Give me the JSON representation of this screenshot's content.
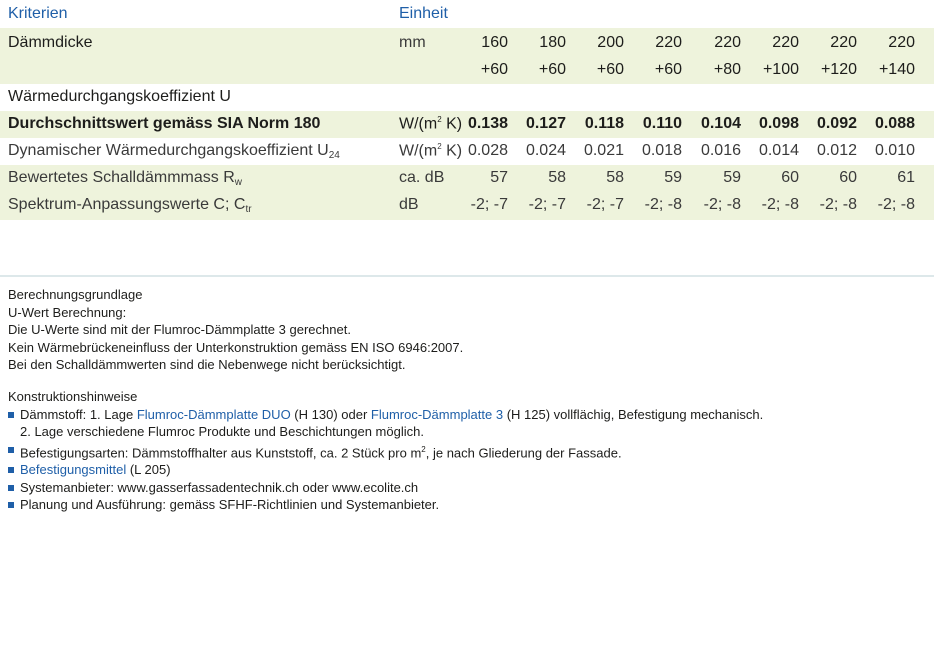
{
  "table": {
    "header": {
      "kriterien": "Kriterien",
      "einheit": "Einheit"
    },
    "daemmdicke": {
      "label": "Dämmdicke",
      "unit": "mm",
      "top": [
        "160",
        "180",
        "200",
        "220",
        "220",
        "220",
        "220",
        "220"
      ],
      "bottom": [
        "+60",
        "+60",
        "+60",
        "+60",
        "+80",
        "+100",
        "+120",
        "+140"
      ]
    },
    "u_heading": "Wärmedurchgangskoeffizient U",
    "u_avg": {
      "label": "Durchschnittswert gemäss SIA Norm 180",
      "unit_main": "W/(m",
      "unit_sup": "2",
      "unit_end": " K)",
      "values": [
        "0.138",
        "0.127",
        "0.118",
        "0.110",
        "0.104",
        "0.098",
        "0.092",
        "0.088"
      ]
    },
    "u_dyn": {
      "label": "Dynamischer Wärmedurchgangskoeffizient U",
      "label_sub": "24",
      "unit_main": "W/(m",
      "unit_sup": "2",
      "unit_end": " K)",
      "values": [
        "0.028",
        "0.024",
        "0.021",
        "0.018",
        "0.016",
        "0.014",
        "0.012",
        "0.010"
      ]
    },
    "schall": {
      "label": "Bewertetes Schalldämmmass R",
      "label_sub": "w",
      "unit": "ca. dB",
      "values": [
        "57",
        "58",
        "58",
        "59",
        "59",
        "60",
        "60",
        "61"
      ]
    },
    "spektrum": {
      "label": "Spektrum-Anpassungswerte C; C",
      "label_sub": "tr",
      "unit": "dB",
      "values": [
        "-2; -7",
        "-2; -7",
        "-2; -7",
        "-2; -8",
        "-2; -8",
        "-2; -8",
        "-2; -8",
        "-2; -8"
      ]
    }
  },
  "berechnung": {
    "title": "Berechnungsgrundlage",
    "lines": [
      "U-Wert Berechnung:",
      "Die U-Werte sind mit der Flumroc-Dämmplatte 3 gerechnet.",
      "Kein Wärmebrückeneinfluss der Unterkonstruktion gemäss EN ISO 6946:2007.",
      "Bei den Schalldämmwerten sind die Nebenwege nicht berücksichtigt."
    ]
  },
  "konstruktion": {
    "title": "Konstruktionshinweise",
    "b1_a": "Dämmstoff: 1. Lage ",
    "b1_link1": "Flumroc-Dämmplatte DUO",
    "b1_b": " (H 130) oder ",
    "b1_link2": "Flumroc-Dämmplatte 3",
    "b1_c": " (H 125) vollflächig, Befestigung mechanisch.",
    "b1_cont": "2. Lage verschiedene Flumroc Produkte und Beschichtungen möglich.",
    "b2_a": "Befestigungsarten: Dämmstoffhalter aus Kunststoff, ca. 2 Stück pro m",
    "b2_sup": "2",
    "b2_b": ", je nach Gliederung der Fassade.",
    "b3_link": "Befestigungsmittel",
    "b3_b": " (L 205)",
    "b4": "Systemanbieter: www.gasserfassadentechnik.ch oder www.ecolite.ch",
    "b5": "Planung und Ausführung: gemäss SFHF-Richtlinien und Systemanbieter."
  },
  "colors": {
    "accent": "#1f5fa8",
    "row_tint": "#eef3dc",
    "separator": "#dde8ea"
  }
}
